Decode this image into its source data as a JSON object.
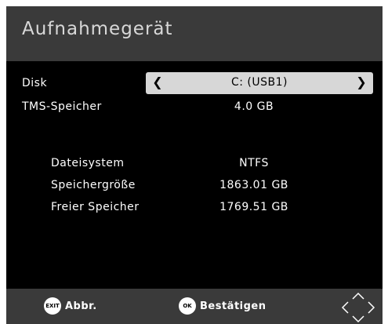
{
  "header": {
    "title": "Aufnahmegerät"
  },
  "settings": {
    "disk": {
      "label": "Disk",
      "value": "C: (USB1)",
      "left_arrow": "❮",
      "right_arrow": "❯"
    },
    "tms": {
      "label": "TMS-Speicher",
      "value": "4.0 GB"
    }
  },
  "info": {
    "filesystem": {
      "label": "Dateisystem",
      "value": "NTFS"
    },
    "size": {
      "label": "Speichergröße",
      "value": "1863.01 GB"
    },
    "free": {
      "label": "Freier Speicher",
      "value": "1769.51 GB"
    }
  },
  "footer": {
    "exit": {
      "icon_text": "EXIT",
      "label": "Abbr."
    },
    "ok": {
      "icon_text": "OK",
      "label": "Bestätigen"
    },
    "nav_icon": "dpad-icon"
  },
  "colors": {
    "background": "#000000",
    "bars": "#3a3a3a",
    "selector": "#d7d7d7",
    "text": "#ffffff"
  }
}
